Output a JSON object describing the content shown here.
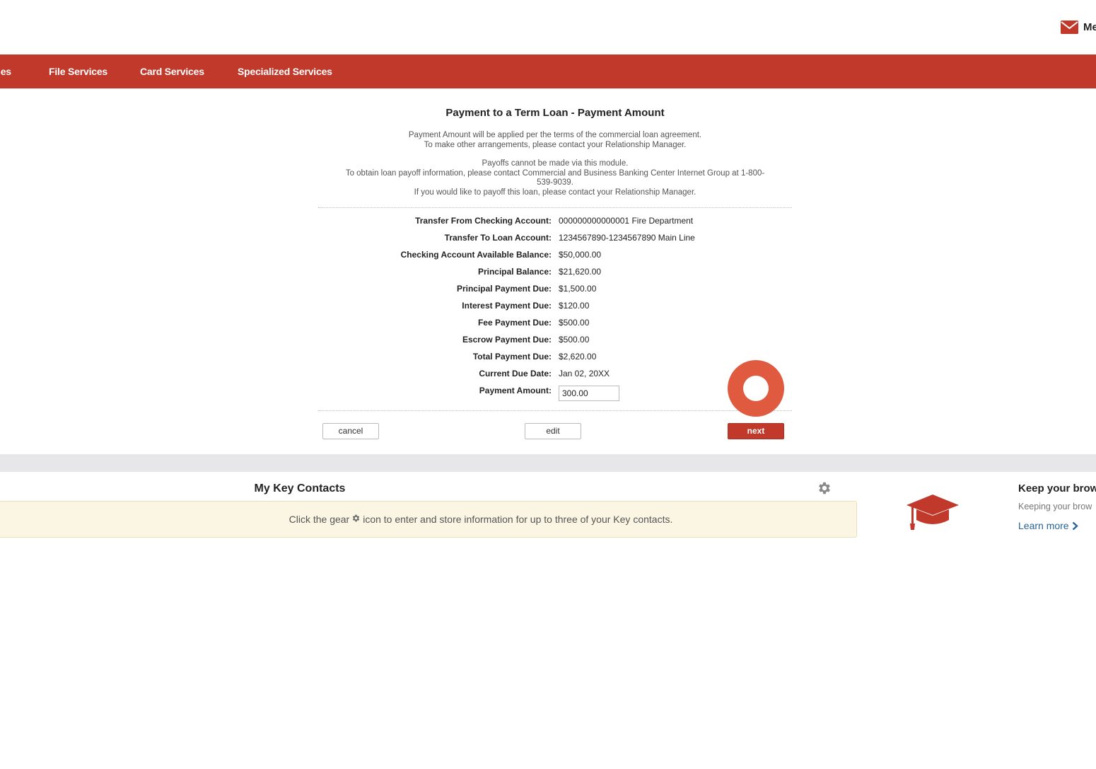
{
  "header": {
    "mail_label": "Me"
  },
  "nav": {
    "items": [
      {
        "label": "les"
      },
      {
        "label": "File Services"
      },
      {
        "label": "Card Services"
      },
      {
        "label": "Specialized Services"
      }
    ]
  },
  "form": {
    "title": "Payment to a Term Loan - Payment Amount",
    "note1_line1": "Payment Amount will be applied per the terms of the commercial loan agreement.",
    "note1_line2": "To make other arrangements, please contact your Relationship Manager.",
    "note2_line1": "Payoffs cannot be made via this module.",
    "note2_line2": "To obtain loan payoff information, please contact Commercial and Business Banking Center Internet Group at 1-800-539-9039.",
    "note2_line3": "If you would like to payoff this loan, please contact your Relationship Manager.",
    "rows": [
      {
        "label": "Transfer From Checking Account:",
        "value": "000000000000001 Fire Department"
      },
      {
        "label": "Transfer To Loan Account:",
        "value": "1234567890-1234567890 Main Line"
      },
      {
        "label": "Checking Account Available Balance:",
        "value": "$50,000.00"
      },
      {
        "label": "Principal Balance:",
        "value": "$21,620.00"
      },
      {
        "label": "Principal Payment Due:",
        "value": "$1,500.00"
      },
      {
        "label": "Interest Payment Due:",
        "value": "$120.00"
      },
      {
        "label": "Fee Payment Due:",
        "value": "$500.00"
      },
      {
        "label": "Escrow Payment Due:",
        "value": "$500.00"
      },
      {
        "label": "Total Payment Due:",
        "value": "$2,620.00"
      },
      {
        "label": "Current Due Date:",
        "value": "Jan 02, 20XX"
      }
    ],
    "payment_amount_label": "Payment Amount:",
    "payment_amount_value": "300.00",
    "cancel_label": "cancel",
    "edit_label": "edit",
    "next_label": "next"
  },
  "contacts": {
    "title": "My Key Contacts",
    "message_before": "Click the gear",
    "message_after": "icon to enter and store information for up to three of your Key contacts."
  },
  "promo": {
    "title": "Keep your brow",
    "text": "Keeping your brow",
    "link": "Learn more"
  },
  "colors": {
    "brand_red": "#c0392b",
    "tap_marker": "#e05a40",
    "link_blue": "#2a6496"
  }
}
